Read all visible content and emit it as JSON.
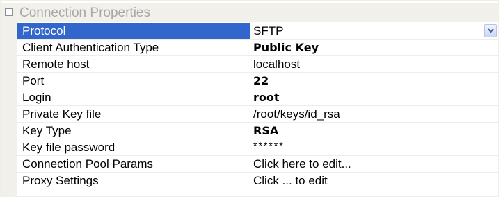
{
  "grid": {
    "category": {
      "title": "Connection Properties",
      "expanded": true,
      "toggle_symbol": "⊟"
    },
    "properties": [
      {
        "name": "Protocol",
        "value": "SFTP",
        "bold": false,
        "selected": true,
        "has_dropdown": true
      },
      {
        "name": "Client Authentication Type",
        "value": "Public Key",
        "bold": true
      },
      {
        "name": "Remote host",
        "value": "localhost",
        "bold": false
      },
      {
        "name": "Port",
        "value": "22",
        "bold": true
      },
      {
        "name": "Login",
        "value": "root",
        "bold": true
      },
      {
        "name": "Private Key file",
        "value": "/root/keys/id_rsa",
        "bold": false
      },
      {
        "name": "Key Type",
        "value": "RSA",
        "bold": true
      },
      {
        "name": "Key file password",
        "value": "******",
        "bold": false,
        "masked": true
      },
      {
        "name": "Connection Pool Params",
        "value": "Click here to edit...",
        "bold": false
      },
      {
        "name": "Proxy Settings",
        "value": "Click ... to edit",
        "bold": false
      }
    ]
  },
  "colors": {
    "selection": "#3366cc",
    "category_background": "#f1f0ea",
    "category_text": "#a8a8a8",
    "grid_line": "#eeedea",
    "dropdown_arrow": "#4d6185"
  },
  "icons": {
    "collapse": "minus-box-icon",
    "dropdown": "chevron-down-icon"
  }
}
